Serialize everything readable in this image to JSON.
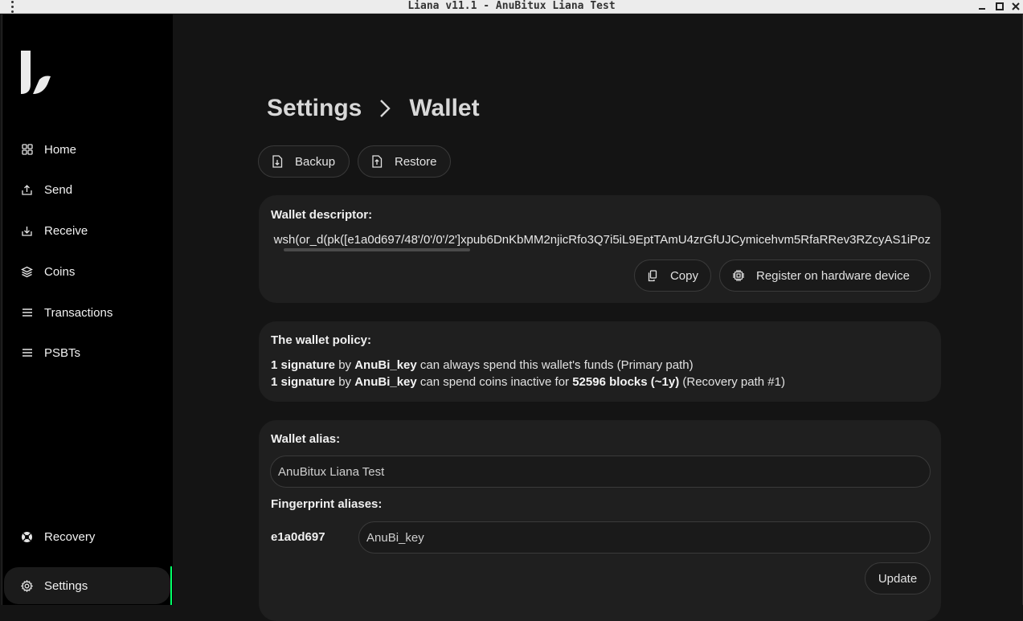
{
  "window": {
    "title": "Liana v11.1 - AnuBitux Liana Test"
  },
  "sidebar": {
    "items": [
      {
        "label": "Home",
        "icon": "grid-icon"
      },
      {
        "label": "Send",
        "icon": "send-icon"
      },
      {
        "label": "Receive",
        "icon": "receive-icon"
      },
      {
        "label": "Coins",
        "icon": "coins-icon"
      },
      {
        "label": "Transactions",
        "icon": "list-icon"
      },
      {
        "label": "PSBTs",
        "icon": "list-icon"
      }
    ],
    "bottom_items": [
      {
        "label": "Recovery",
        "icon": "lifebuoy-icon"
      },
      {
        "label": "Settings",
        "icon": "gear-icon",
        "active": true
      }
    ],
    "accent_color": "#00ff66"
  },
  "breadcrumb": {
    "parent": "Settings",
    "current": "Wallet"
  },
  "actions": {
    "backup_label": "Backup",
    "restore_label": "Restore"
  },
  "descriptor_card": {
    "label": "Wallet descriptor:",
    "value": "wsh(or_d(pk([e1a0d697/48'/0'/0'/2']xpub6DnKbMM2njicRfo3Q7i5iL9EptTAmU4zrGfUJCymicehvm5RfaRRev3RZcyAS1iPoz",
    "copy_label": "Copy",
    "register_label": "Register on hardware device"
  },
  "policy_card": {
    "label": "The wallet policy:",
    "primary": {
      "count": "1 signature",
      "by": "by",
      "key": "AnuBi_key",
      "text": "can always spend this wallet's funds (Primary path)"
    },
    "recovery": {
      "count": "1 signature",
      "by": "by",
      "key": "AnuBi_key",
      "text1": "can spend coins inactive for",
      "blocks": "52596 blocks (~1y)",
      "text2": "(Recovery path #1)"
    }
  },
  "alias_card": {
    "wallet_alias_label": "Wallet alias:",
    "wallet_alias_value": "AnuBitux Liana Test",
    "fingerprint_label": "Fingerprint aliases:",
    "fingerprint": "e1a0d697",
    "fingerprint_alias_value": "AnuBi_key",
    "update_label": "Update"
  }
}
